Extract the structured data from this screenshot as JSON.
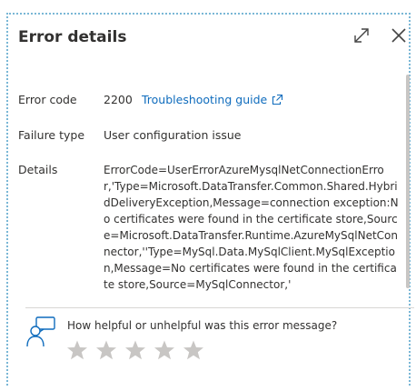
{
  "dialog": {
    "title": "Error details",
    "expand_icon": "expand-icon",
    "close_icon": "close-icon"
  },
  "fields": {
    "error_code_label": "Error code",
    "error_code_value": "2200",
    "troubleshooting_link": "Troubleshooting guide",
    "failure_type_label": "Failure type",
    "failure_type_value": "User configuration issue",
    "details_label": "Details",
    "details_value": "ErrorCode=UserErrorAzureMysqlNetConnectionError,'Type=Microsoft.DataTransfer.Common.Shared.HybridDeliveryException,Message=connection exception:No certificates were found in the certificate store,Source=Microsoft.DataTransfer.Runtime.AzureMySqlNetConnector,''Type=MySql.Data.MySqlClient.MySqlException,Message=No certificates were found in the certificate store,Source=MySqlConnector,'"
  },
  "feedback": {
    "question": "How helpful or unhelpful was this error message?",
    "icon": "feedback-person-icon",
    "stars_total": 5,
    "stars_selected": 0,
    "star_color": "#c8c6c4"
  },
  "colors": {
    "link": "#0f6cbd",
    "dotted_border": "#7ab7d6"
  }
}
